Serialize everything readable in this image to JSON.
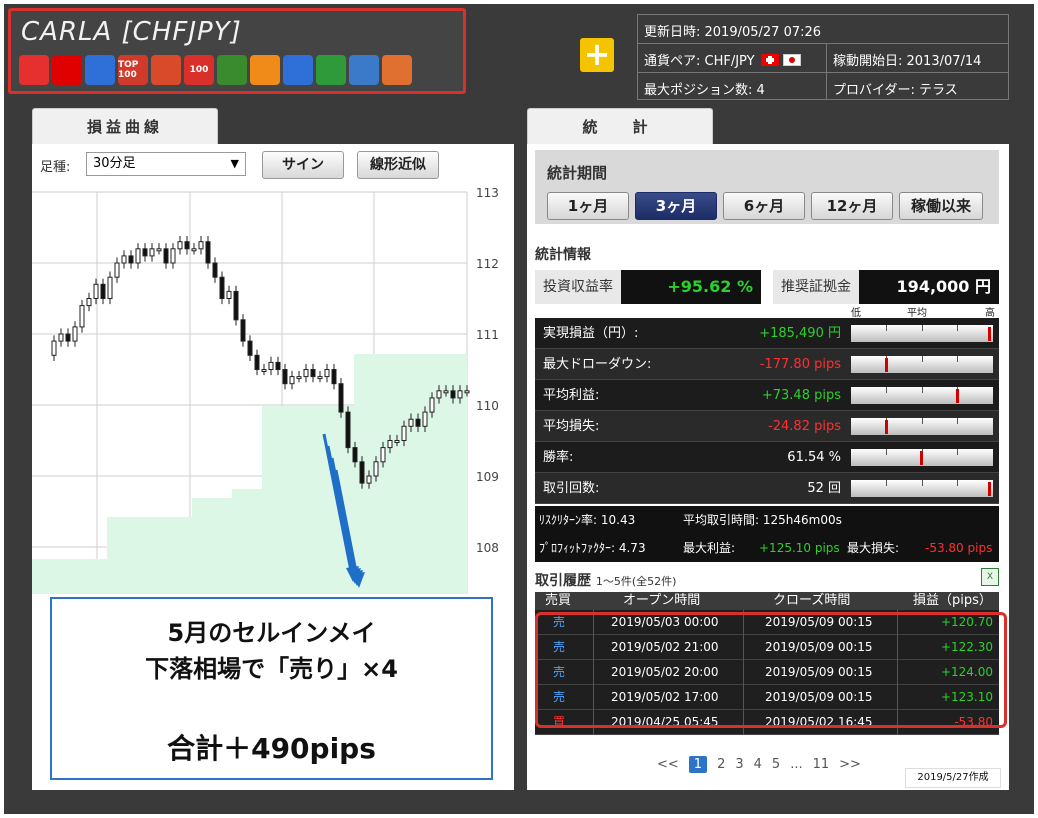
{
  "header": {
    "title": "CARLA [CHFJPY]",
    "icons": [
      {
        "name": "bomb-red-icon",
        "color": "#e63030",
        "text": ""
      },
      {
        "name": "red-dot-icon",
        "color": "#e00000",
        "text": ""
      },
      {
        "name": "boomerang-icon",
        "color": "#2f6fd8",
        "text": ""
      },
      {
        "name": "top100-icon",
        "color": "#d03a2a",
        "text": "TOP 100"
      },
      {
        "name": "stopwatch-icon",
        "color": "#d94a2a",
        "text": ""
      },
      {
        "name": "100-badge-icon",
        "color": "#d9302c",
        "text": "100"
      },
      {
        "name": "beginner-leaf-icon",
        "color": "#3a8a2e",
        "text": ""
      },
      {
        "name": "orange-ball-icon",
        "color": "#f08a18",
        "text": ""
      },
      {
        "name": "arrows-icon",
        "color": "#2f6fd8",
        "text": ""
      },
      {
        "name": "tree-icon",
        "color": "#2f9a3a",
        "text": ""
      },
      {
        "name": "scale-icon",
        "color": "#3a7ac8",
        "text": ""
      },
      {
        "name": "target-icon",
        "color": "#e07030",
        "text": ""
      }
    ],
    "info": {
      "updated": "更新日時: 2019/05/27 07:26",
      "pair": "通貨ペア: CHF/JPY",
      "start": "稼動開始日: 2013/07/14",
      "maxpos": "最大ポジション数: 4",
      "provider": "プロバイダー: テラス"
    }
  },
  "left": {
    "tab": "損益曲線",
    "foot_label": "足種:",
    "foot_value": "30分足",
    "btn_sign": "サイン",
    "btn_linear": "線形近似",
    "y_ticks": [
      "113",
      "112",
      "111",
      "110",
      "109",
      "108"
    ],
    "callout": {
      "line1": "5月のセルインメイ",
      "line2": "下落相場で「売り」×4",
      "line3": "合計＋490pips"
    }
  },
  "right": {
    "tab": "統　計",
    "period_label": "統計期間",
    "periods": [
      "1ヶ月",
      "3ヶ月",
      "6ヶ月",
      "12ヶ月",
      "稼働以来"
    ],
    "active_period": 1,
    "stats_title": "統計情報",
    "kpi": {
      "roi_label": "投資収益率",
      "roi_value": "+95.62 %",
      "margin_label": "推奨証拠金",
      "margin_value": "194,000 円"
    },
    "scale": {
      "low": "低",
      "mid": "平均",
      "high": "高"
    },
    "rows": [
      {
        "label": "実現損益（円）:",
        "value": "+185,490 円",
        "color": "#2bd12b",
        "marker": 0.98
      },
      {
        "label": "最大ドローダウン:",
        "value": "-177.80 pips",
        "color": "#ff3030",
        "marker": 0.25
      },
      {
        "label": "平均利益:",
        "value": "+73.48 pips",
        "color": "#2bd12b",
        "marker": 0.75
      },
      {
        "label": "平均損失:",
        "value": "-24.82 pips",
        "color": "#ff3030",
        "marker": 0.25
      },
      {
        "label": "勝率:",
        "value": "61.54 %",
        "color": "#ffffff",
        "marker": 0.5
      },
      {
        "label": "取引回数:",
        "value": "52 回",
        "color": "#ffffff",
        "marker": 0.98
      }
    ],
    "misc1": {
      "risk_label": "ﾘｽｸﾘﾀｰﾝ率: 10.43",
      "avg_label": "平均取引時間: 125h46m00s"
    },
    "misc2": {
      "pf_label": "ﾌﾟﾛﾌｨｯﾄﾌｧｸﾀｰ: 4.73",
      "maxp_label": "最大利益:",
      "maxp_value": "+125.10 pips",
      "maxl_label": "最大損失:",
      "maxl_value": "-53.80 pips"
    },
    "history_title": "取引履歴",
    "history_count": "1～5件(全52件)",
    "columns": [
      "売買",
      "オープン時間",
      "クローズ時間",
      "損益（pips）"
    ],
    "trades": [
      {
        "side": "売",
        "side_color": "#4da3ff",
        "open": "2019/05/03 00:00",
        "close": "2019/05/09 00:15",
        "pips": "+120.70",
        "pips_color": "#2bd12b"
      },
      {
        "side": "売",
        "side_color": "#4da3ff",
        "open": "2019/05/02 21:00",
        "close": "2019/05/09 00:15",
        "pips": "+122.30",
        "pips_color": "#2bd12b"
      },
      {
        "side": "売",
        "side_color": "#4da3ff",
        "open": "2019/05/02 20:00",
        "close": "2019/05/09 00:15",
        "pips": "+124.00",
        "pips_color": "#2bd12b"
      },
      {
        "side": "売",
        "side_color": "#4da3ff",
        "open": "2019/05/02 17:00",
        "close": "2019/05/09 00:15",
        "pips": "+123.10",
        "pips_color": "#2bd12b"
      },
      {
        "side": "買",
        "side_color": "#ff3030",
        "open": "2019/04/25 05:45",
        "close": "2019/05/02 16:45",
        "pips": "-53.80",
        "pips_color": "#ff3030"
      }
    ],
    "pager": {
      "prev": "<<",
      "pages": [
        "1",
        "2",
        "3",
        "4",
        "5"
      ],
      "ellipsis": "...",
      "last": "11",
      "next": ">>"
    },
    "made": "2019/5/27作成"
  }
}
